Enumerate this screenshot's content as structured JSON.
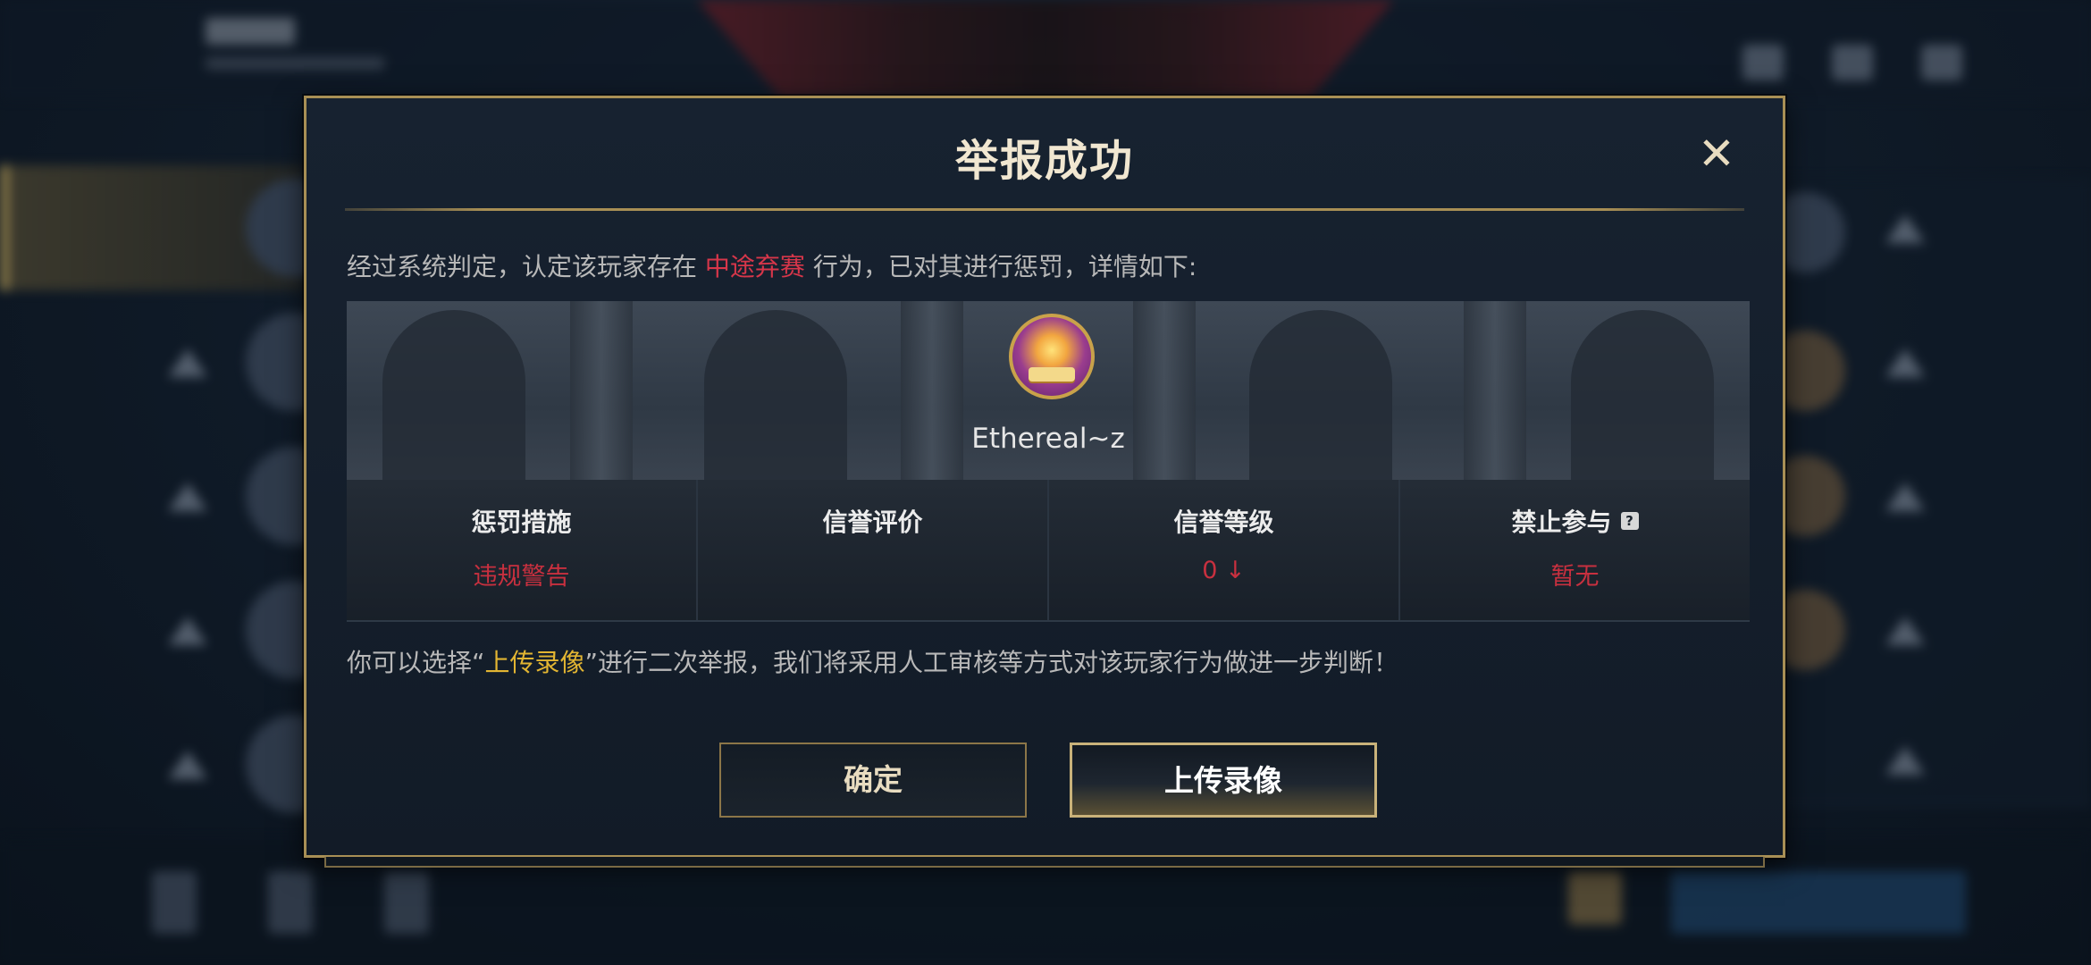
{
  "dialog": {
    "title": "举报成功",
    "close_symbol": "✕",
    "verdict_prefix": "经过系统判定，认定该玩家存在 ",
    "verdict_offense": "中途弃赛",
    "verdict_suffix": " 行为，已对其进行惩罚，详情如下:",
    "player_name": "Ethereal~z",
    "stats": [
      {
        "label": "惩罚措施",
        "value": "违规警告"
      },
      {
        "label": "信誉评价",
        "value": ""
      },
      {
        "label": "信誉等级",
        "value": "0 ↓"
      },
      {
        "label": "禁止参与",
        "value": "暂无",
        "help": "?"
      }
    ],
    "note_prefix": "你可以选择“",
    "note_highlight": "上传录像",
    "note_suffix": "”进行二次举报，我们将采用人工审核等方式对该玩家行为做进一步判断！",
    "confirm_label": "确定",
    "upload_label": "上传录像"
  },
  "colors": {
    "accent_gold": "#a88f55",
    "alert_red": "#d7364a",
    "highlight_yellow": "#e2b532"
  },
  "icons": {
    "close": "close-icon",
    "help": "question-mark-icon",
    "avatar": "player-avatar"
  }
}
